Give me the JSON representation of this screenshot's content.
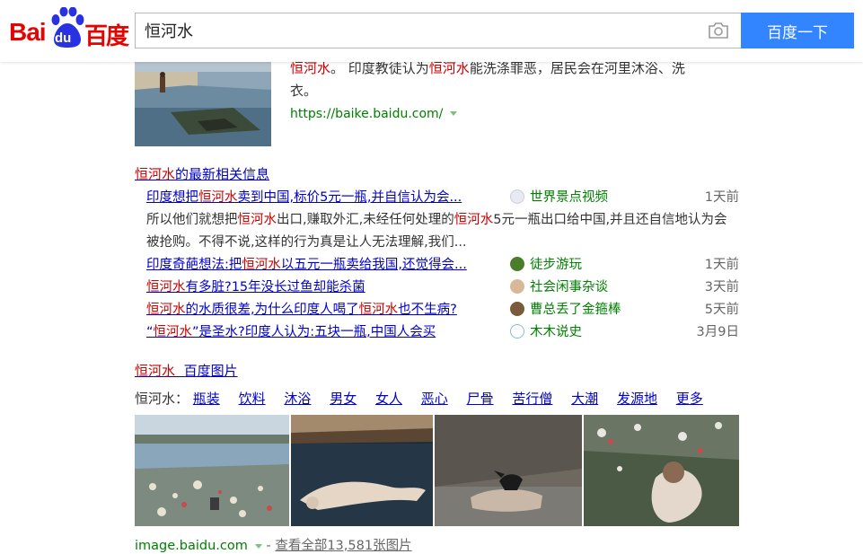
{
  "header": {
    "logo_bai": "Bai",
    "logo_du": "du",
    "logo_cn": "百度",
    "search_value": "恒河水",
    "search_button": "百度一下"
  },
  "baike": {
    "line1_hl": "恒河水",
    "line1_rest": "。 印度教徒认为",
    "line1_hl2": "恒河水",
    "line1_end": "能洗涤罪恶，居民会在河里沐浴、洗",
    "line2": "衣。",
    "url": "https://baike.baidu.com/"
  },
  "news": {
    "title_hl": "恒河水",
    "title_rest": "的最新相关信息",
    "items": [
      {
        "p1": "印度想把",
        "hl1": "恒河水",
        "p2": "卖到中国,标价5元一瓶,并自信认为会...",
        "hl2": "",
        "p3": "",
        "source": "世界景点视频",
        "time": "1天前"
      },
      {
        "p1": "印度奇葩想法:把",
        "hl1": "恒河水",
        "p2": "以五元一瓶卖给我国,还觉得会...",
        "hl2": "",
        "p3": "",
        "source": "徒步游玩",
        "time": "1天前"
      },
      {
        "p1": "",
        "hl1": "恒河水",
        "p2": "有多脏?15年没长过鱼却能杀菌",
        "hl2": "",
        "p3": "",
        "source": "社会闲事杂谈",
        "time": "3天前"
      },
      {
        "p1": "",
        "hl1": "恒河水",
        "p2": "的水质很差,为什么印度人喝了",
        "hl2": "恒河水",
        "p3": "也不生病?",
        "source": "曹总丢了金箍棒",
        "time": "5天前"
      },
      {
        "p1": "“",
        "hl1": "恒河水",
        "p2": "”是圣水?印度人认为:五块一瓶,中国人会买",
        "hl2": "",
        "p3": "",
        "source": "木木说史",
        "time": "3月9日"
      }
    ],
    "abstract": {
      "a1": "所以他们就想把",
      "h1": "恒河水",
      "a2": "出口,赚取外汇,未经任何处理的",
      "h2": "恒河水",
      "a3": "5元一瓶出口给中国,并且还自信地认为会被抢购。不得不说,这样的行为真是让人无法理解,我们..."
    }
  },
  "images": {
    "title_hl": "恒河水",
    "title_rest": "百度图片",
    "tag_label": "恒河水：",
    "tags": [
      "瓶装",
      "饮料",
      "沐浴",
      "男女",
      "女人",
      "恶心",
      "尸骨",
      "苦行僧",
      "大潮",
      "发源地",
      "更多"
    ],
    "footer_url": "image.baidu.com",
    "footer_sep": " - ",
    "footer_more": "查看全部13,581张图片"
  },
  "colors": {
    "brand_red": "#e10602",
    "brand_blue": "#2932e1",
    "button_blue": "#3385ff",
    "link_blue": "#0000cc",
    "highlight_red": "#cc0000",
    "url_green": "#008000"
  }
}
